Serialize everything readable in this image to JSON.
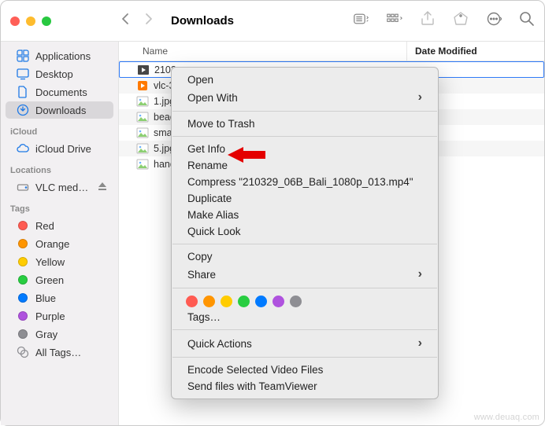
{
  "window": {
    "title": "Downloads"
  },
  "list_header": {
    "name": "Name",
    "date": "Date Modified"
  },
  "sidebar": {
    "favorites": [
      {
        "label": "Applications",
        "icon": "apps"
      },
      {
        "label": "Desktop",
        "icon": "desktop"
      },
      {
        "label": "Documents",
        "icon": "documents"
      },
      {
        "label": "Downloads",
        "icon": "downloads",
        "selected": true
      }
    ],
    "icloud_label": "iCloud",
    "icloud": [
      {
        "label": "iCloud Drive",
        "icon": "cloud"
      }
    ],
    "locations_label": "Locations",
    "locations": [
      {
        "label": "VLC med…",
        "icon": "disk",
        "eject": true
      }
    ],
    "tags_label": "Tags",
    "tags": [
      {
        "label": "Red",
        "color": "#ff5b52"
      },
      {
        "label": "Orange",
        "color": "#ff9500"
      },
      {
        "label": "Yellow",
        "color": "#ffcc00"
      },
      {
        "label": "Green",
        "color": "#28cd41"
      },
      {
        "label": "Blue",
        "color": "#007aff"
      },
      {
        "label": "Purple",
        "color": "#af52de"
      },
      {
        "label": "Gray",
        "color": "#8e8e93"
      }
    ],
    "all_tags": "All Tags…"
  },
  "files": [
    {
      "name": "2103",
      "type": "video",
      "selected": true
    },
    {
      "name": "vlc-3",
      "type": "app"
    },
    {
      "name": "1.jpg",
      "type": "image"
    },
    {
      "name": "bead",
      "type": "image"
    },
    {
      "name": "sma",
      "type": "image"
    },
    {
      "name": "5.jpg",
      "type": "image"
    },
    {
      "name": "hand",
      "type": "image"
    }
  ],
  "menu": {
    "open": "Open",
    "open_with": "Open With",
    "trash": "Move to Trash",
    "get_info": "Get Info",
    "rename": "Rename",
    "compress": "Compress \"210329_06B_Bali_1080p_013.mp4\"",
    "duplicate": "Duplicate",
    "alias": "Make Alias",
    "quicklook": "Quick Look",
    "copy": "Copy",
    "share": "Share",
    "tags": "Tags…",
    "quick_actions": "Quick Actions",
    "encode": "Encode Selected Video Files",
    "teamviewer": "Send files with TeamViewer",
    "tag_colors": [
      "#ff5b52",
      "#ff9500",
      "#ffcc00",
      "#28cd41",
      "#007aff",
      "#af52de",
      "#8e8e93"
    ]
  },
  "watermark": "www.deuaq.com"
}
